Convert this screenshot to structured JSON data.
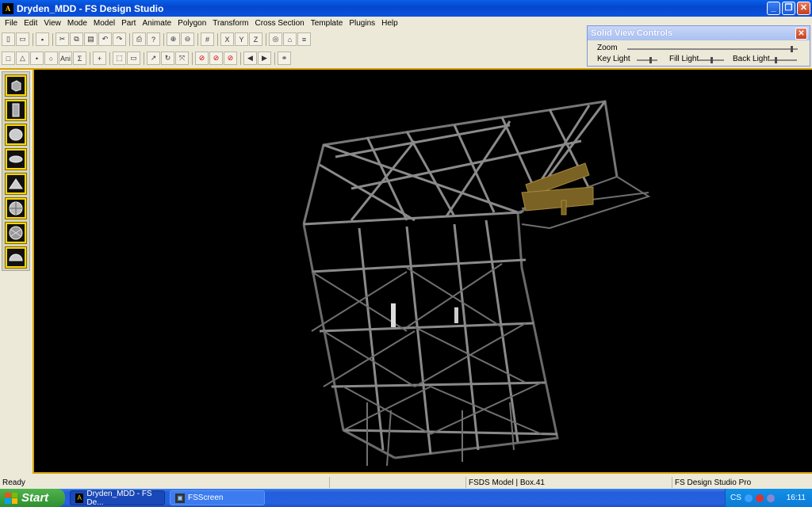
{
  "window": {
    "title": "Dryden_MDD - FS Design Studio",
    "icon": "fsds-app-icon"
  },
  "menubar": {
    "items": [
      "File",
      "Edit",
      "View",
      "Mode",
      "Model",
      "Part",
      "Animate",
      "Polygon",
      "Transform",
      "Cross Section",
      "Template",
      "Plugins",
      "Help"
    ]
  },
  "toolbar1": {
    "buttons": [
      "new-icon",
      "open-icon",
      "save-icon",
      "cut-icon",
      "copy-icon",
      "paste-icon",
      "undo-icon",
      "redo-icon",
      "print-icon",
      "help-icon",
      "zoom-in-icon",
      "zoom-out-icon",
      "grid-icon",
      "align-x-icon",
      "align-y-icon",
      "align-z-icon",
      "view-icon",
      "home-icon",
      "frame-icon"
    ]
  },
  "toolbar2": {
    "buttons": [
      "select-icon",
      "triangle-icon",
      "point-icon",
      "circle-icon",
      "ani-icon",
      "sum-icon",
      "add-icon",
      "box-select-icon",
      "ruler-icon",
      "rotate-icon",
      "redo-arrow-icon",
      "scale-icon",
      "stop-icon",
      "stop2-icon",
      "stop3-icon",
      "prev-icon",
      "next-icon",
      "binoculars-icon"
    ],
    "labels": {
      "ani": "Ani",
      "sum": "Σ"
    }
  },
  "left_panel": {
    "shapes": [
      "cube-icon",
      "cylinder-icon",
      "sphere-icon",
      "ellipse-icon",
      "pyramid-icon",
      "geosphere-icon",
      "textured-sphere-icon",
      "hemisphere-icon"
    ]
  },
  "solid_view_controls": {
    "title": "Solid View Controls",
    "zoom_label": "Zoom",
    "key_light_label": "Key Light",
    "fill_light_label": "Fill Light",
    "back_light_label": "Back Light",
    "zoom_level": 0.97,
    "key_light_level": 0.7,
    "fill_light_level": 0.5,
    "back_light_level": 0.2
  },
  "statusbar": {
    "ready": "Ready",
    "model": "FSDS Model | Box.41",
    "product": "FS Design Studio Pro"
  },
  "taskbar": {
    "start": "Start",
    "tasks": [
      "Dryden_MDD - FS De...",
      "FSScreen"
    ],
    "tray_lang": "CS",
    "clock": "16:11"
  }
}
